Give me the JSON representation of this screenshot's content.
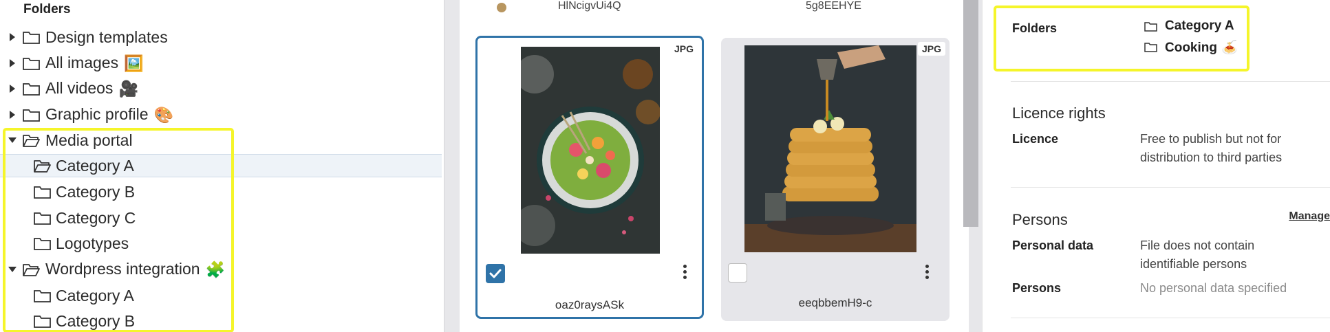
{
  "tree": {
    "title": "Folders",
    "rows": [
      {
        "label": "Design templates",
        "emoji": ""
      },
      {
        "label": "All images",
        "emoji": "🖼️"
      },
      {
        "label": "All videos",
        "emoji": "🎥"
      },
      {
        "label": "Graphic profile",
        "emoji": "🎨"
      },
      {
        "label": "Media portal",
        "emoji": ""
      },
      {
        "label": "Category A",
        "emoji": ""
      },
      {
        "label": "Category B",
        "emoji": ""
      },
      {
        "label": "Category C",
        "emoji": ""
      },
      {
        "label": "Logotypes",
        "emoji": ""
      },
      {
        "label": "Wordpress integration",
        "emoji": "🧩"
      },
      {
        "label": "Category A",
        "emoji": ""
      },
      {
        "label": "Category B",
        "emoji": ""
      }
    ]
  },
  "grid": {
    "top_left_name": "HlNcigvUi4Q",
    "top_right_name": "5g8EEHYE",
    "cards": [
      {
        "badge": "JPG",
        "name": "oaz0raysASk",
        "checked": true
      },
      {
        "badge": "JPG",
        "name": "eeqbbemH9-c",
        "checked": false
      }
    ]
  },
  "detail": {
    "folders_label": "Folders",
    "folders": [
      {
        "name": "Category A",
        "emoji": ""
      },
      {
        "name": "Cooking",
        "emoji": "🍝"
      }
    ],
    "licence_heading": "Licence rights",
    "licence_label": "Licence",
    "licence_value_line1": "Free to publish but not for",
    "licence_value_line2": "distribution to third parties",
    "persons_heading": "Persons",
    "manage_label": "Manage",
    "personal_data_label": "Personal data",
    "personal_data_line1": "File does not contain",
    "personal_data_line2": "identifiable persons",
    "persons_label": "Persons",
    "persons_value": "No personal data specified"
  },
  "colors": {
    "highlight": "#f5f52a",
    "accent": "#2f73a8",
    "selected_row_bg": "#eef3f8"
  }
}
